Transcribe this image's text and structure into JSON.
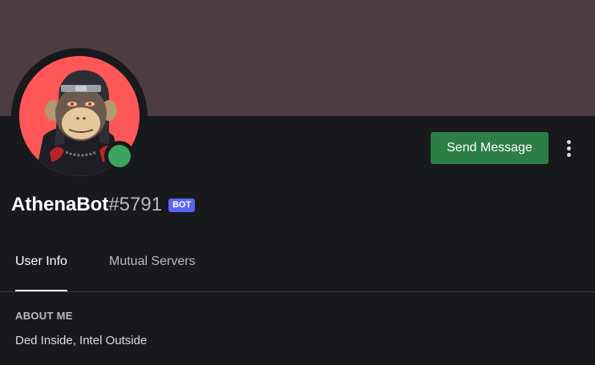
{
  "profile": {
    "username": "AthenaBot",
    "discriminator": "#5791",
    "bot_tag": "BOT",
    "status": "online",
    "avatar": "ape-avatar-with-headband"
  },
  "actions": {
    "send_message_label": "Send Message",
    "more_icon": "vertical-ellipsis-icon"
  },
  "tabs": [
    {
      "label": "User Info",
      "active": true
    },
    {
      "label": "Mutual Servers",
      "active": false
    }
  ],
  "about": {
    "header": "ABOUT ME",
    "text": "Ded Inside, Intel Outside"
  },
  "colors": {
    "banner": "#4e3c43",
    "background": "#18191c",
    "avatar_bg": "#ff5757",
    "send_button": "#2d7d46",
    "status_online": "#3ba55d",
    "bot_tag": "#5865f2"
  }
}
